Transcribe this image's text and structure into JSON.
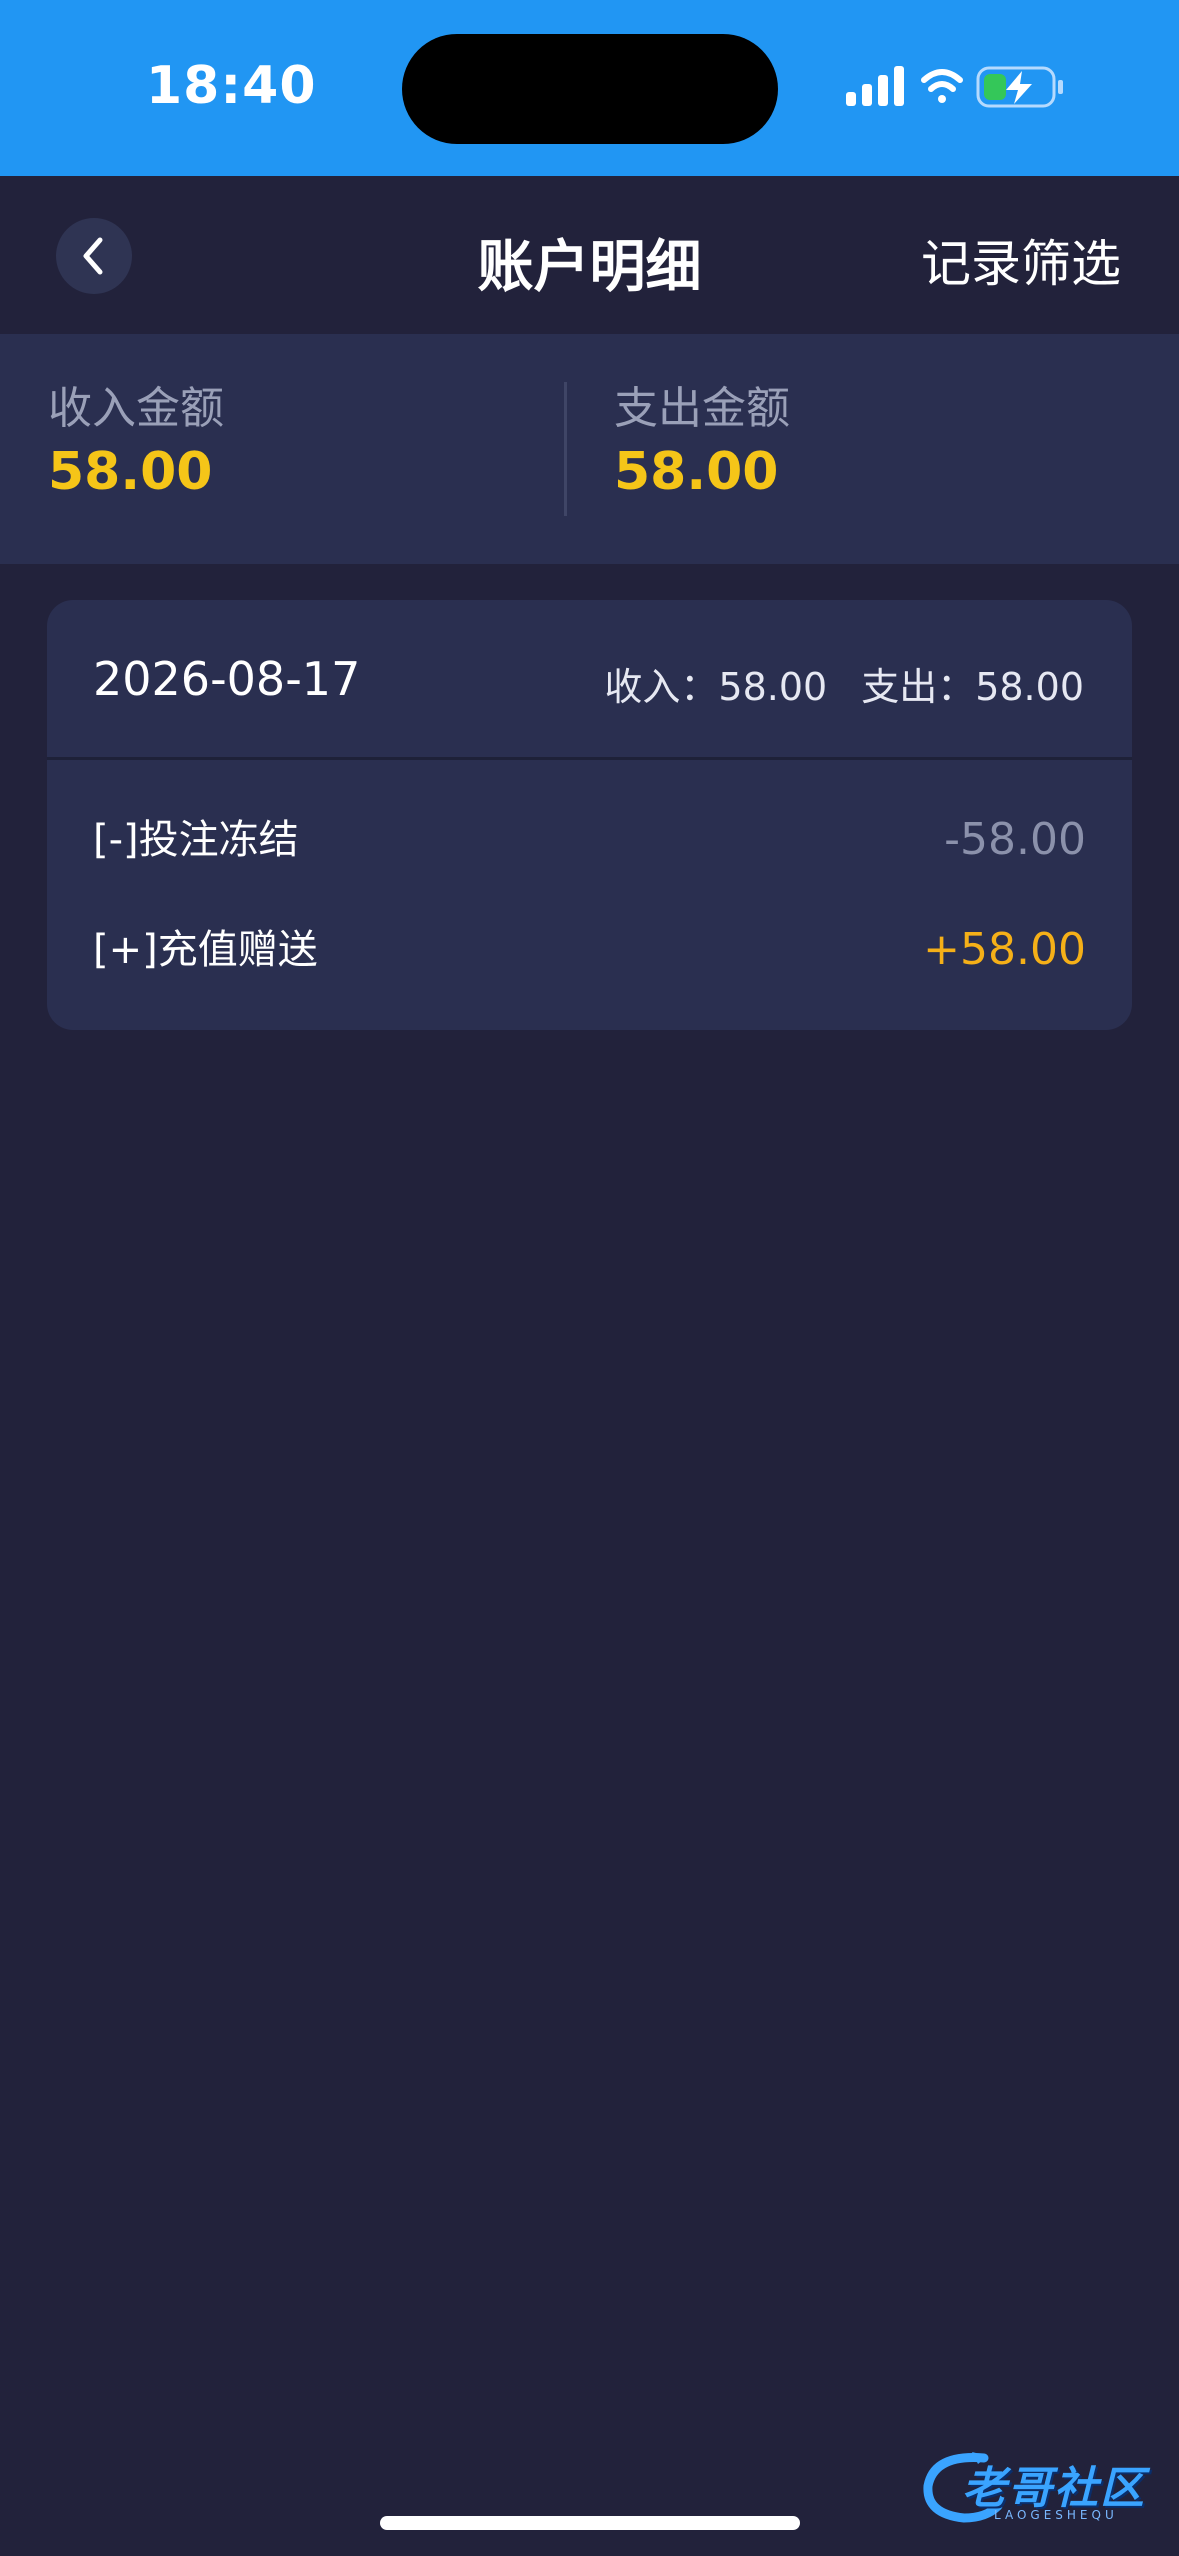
{
  "status_bar": {
    "time": "18:40",
    "background": "#2196f3"
  },
  "nav": {
    "back_icon": "chevron-left-icon",
    "title": "账户明细",
    "filter_label": "记录筛选"
  },
  "summary": {
    "income_label": "收入金额",
    "income_value": "58.00",
    "expense_label": "支出金额",
    "expense_value": "58.00",
    "value_color": "#f5c518"
  },
  "day": {
    "date": "2026-08-17",
    "income_label": "收入：",
    "income_value": "58.00",
    "expense_label": "支出：",
    "expense_value": "58.00",
    "entries": [
      {
        "label": "[-]投注冻结",
        "amount": "-58.00"
      },
      {
        "label": "[+]充值赠送",
        "amount": "+58.00"
      }
    ]
  },
  "watermark": {
    "text": "老哥社区",
    "sub": "LAOGESHEQU"
  }
}
